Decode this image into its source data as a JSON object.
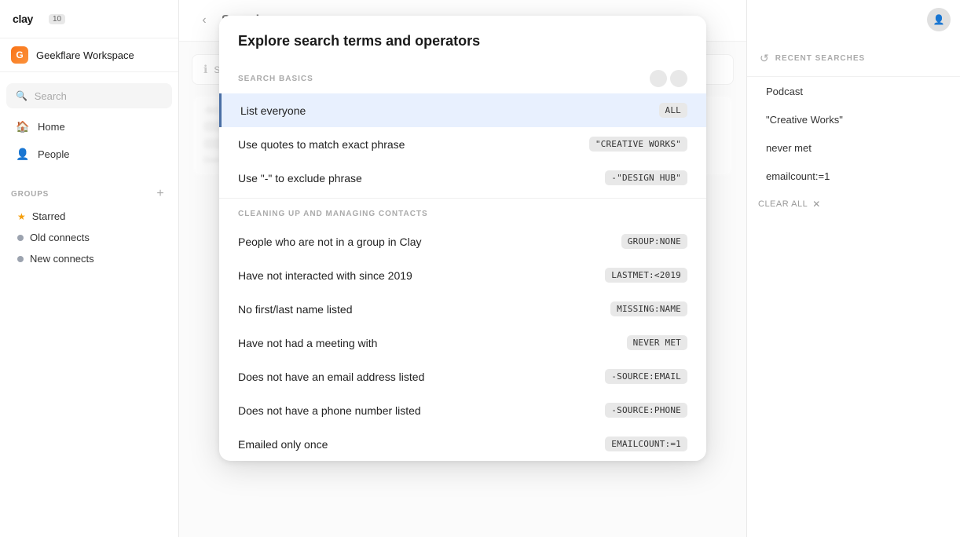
{
  "app": {
    "logo_text": "clay",
    "badge": "10"
  },
  "workspace": {
    "name": "Geekflare Workspace",
    "icon_text": "G"
  },
  "sidebar": {
    "search_placeholder": "Search",
    "nav_items": [
      {
        "id": "search",
        "label": "Search",
        "icon": "🔍"
      },
      {
        "id": "home",
        "label": "Home",
        "icon": "🏠"
      },
      {
        "id": "people",
        "label": "People",
        "icon": "👤"
      }
    ],
    "groups_label": "GROUPS",
    "groups": [
      {
        "id": "starred",
        "label": "Starred",
        "dot_class": "starred"
      },
      {
        "id": "old-connects",
        "label": "Old connects",
        "dot_class": "old"
      },
      {
        "id": "new-connects",
        "label": "New connects",
        "dot_class": "new"
      }
    ]
  },
  "main": {
    "back_label": "‹",
    "title": "Search",
    "search_tips_label": "SEARCH TIPS",
    "blurred_rows": [
      "",
      "",
      "",
      ""
    ]
  },
  "modal": {
    "title": "Explore search terms and operators",
    "section_basics": "SEARCH BASICS",
    "section_cleaning": "CLEANING UP AND MANAGING CONTACTS",
    "rows_basics": [
      {
        "text": "List everyone",
        "badge": "ALL",
        "active": true
      },
      {
        "text": "Use quotes to match exact phrase",
        "badge": "\"CREATIVE WORKS\""
      },
      {
        "text": "Use \"-\" to exclude phrase",
        "badge": "-\"DESIGN HUB\""
      }
    ],
    "rows_cleaning": [
      {
        "text": "People who are not in a group in Clay",
        "badge": "GROUP:NONE"
      },
      {
        "text": "Have not interacted with since 2019",
        "badge": "LASTMET:<2019"
      },
      {
        "text": "No first/last name listed",
        "badge": "MISSING:NAME"
      },
      {
        "text": "Have not had a meeting with",
        "badge": "NEVER MET"
      },
      {
        "text": "Does not have an email address listed",
        "badge": "-SOURCE:EMAIL"
      },
      {
        "text": "Does not have a phone number listed",
        "badge": "-SOURCE:PHONE"
      },
      {
        "text": "Emailed only once",
        "badge": "EMAILCOUNT:=1"
      }
    ]
  },
  "right_panel": {
    "title": "RECENT SEARCHES",
    "recent_items": [
      {
        "id": "podcast",
        "text": "Podcast"
      },
      {
        "id": "creative-works",
        "text": "\"Creative Works\""
      },
      {
        "id": "never-met",
        "text": "never met"
      },
      {
        "id": "emailcount",
        "text": "emailcount:=1"
      }
    ],
    "clear_all_label": "CLEAR ALL"
  }
}
